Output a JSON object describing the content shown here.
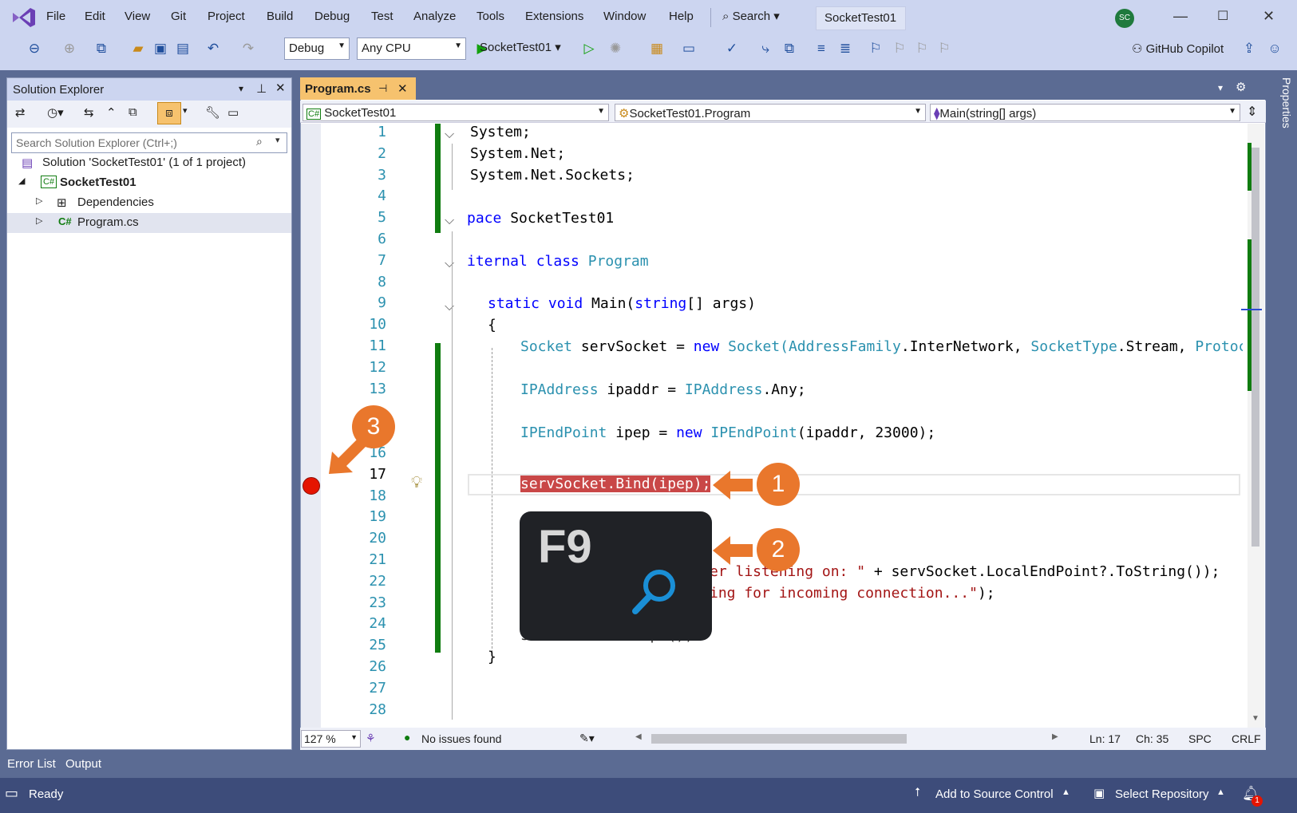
{
  "menu": [
    "File",
    "Edit",
    "View",
    "Git",
    "Project",
    "Build",
    "Debug",
    "Test",
    "Analyze",
    "Tools",
    "Extensions",
    "Window",
    "Help"
  ],
  "title_search": "Search",
  "title_project": "SocketTest01",
  "avatar_initials": "SC",
  "toolbar": {
    "config": "Debug",
    "platform": "Any CPU",
    "run_target": "SocketTest01",
    "copilot": "GitHub Copilot"
  },
  "solution_explorer": {
    "title": "Solution Explorer",
    "search_placeholder": "Search Solution Explorer (Ctrl+;)",
    "items": [
      {
        "label": "Solution 'SocketTest01' (1 of 1 project)"
      },
      {
        "label": "SocketTest01"
      },
      {
        "label": "Dependencies"
      },
      {
        "label": "Program.cs"
      }
    ]
  },
  "editor": {
    "tab": "Program.cs",
    "nav_project": "SocketTest01",
    "nav_class": "SocketTest01.Program",
    "nav_member": "Main(string[] args)",
    "line_numbers": [
      "1",
      "2",
      "3",
      "4",
      "5",
      "6",
      "7",
      "8",
      "9",
      "10",
      "11",
      "12",
      "13",
      "",
      "",
      "16",
      "17",
      "18",
      "19",
      "20",
      "21",
      "22",
      "23",
      "24",
      "25",
      "26",
      "27",
      "28"
    ],
    "code": {
      "l1": "System;",
      "l2": "System.Net;",
      "l3": "System.Net.Sockets;",
      "l5_kw": "pace",
      "l5_rest": " SocketTest01",
      "l7_kw": "iternal class",
      "l7_rest": " Program",
      "l9_a": "static void",
      "l9_b": " Main(",
      "l9_c": "string",
      "l9_d": "[] args)",
      "l10": "{",
      "l11_a": "Socket",
      "l11_b": " servSocket = ",
      "l11_c": "new",
      "l11_d": " Socket(",
      "l11_e": "AddressFamily",
      "l11_f": ".InterNetwork, ",
      "l11_g": "SocketType",
      "l11_h": ".Stream, ",
      "l11_i": "Protocol",
      "l13_a": "IPAddress",
      "l13_b": " ipaddr = ",
      "l13_c": "IPAddress",
      "l13_d": ".Any;",
      "l15_a": "IPEndPoint",
      "l15_b": " ipep = ",
      "l15_c": "new",
      "l15_d": " IPEndPoint",
      "l15_e": "(ipaddr, 23000);",
      "l17": "servSocket.Bind(ipep);",
      "l21_a": "er listening on: \"",
      "l21_b": " + servSocket.LocalEndPoint?.ToString());",
      "l22_a": "ing for incoming connection...\"",
      "l22_b": ");",
      "l24": "servSocket.Accept();",
      "l25": "}"
    },
    "zoom": "127 %",
    "issues": "No issues found",
    "ln": "Ln: 17",
    "ch": "Ch: 35",
    "spc": "SPC",
    "crlf": "CRLF"
  },
  "properties_tab": "Properties",
  "overlay": {
    "f9": "F9",
    "b1": "1",
    "b2": "2",
    "b3": "3"
  },
  "bottom_tabs": [
    "Error List",
    "Output"
  ],
  "status": {
    "ready": "Ready",
    "source_control": "Add to Source Control",
    "repo": "Select Repository",
    "notifications": "1"
  }
}
